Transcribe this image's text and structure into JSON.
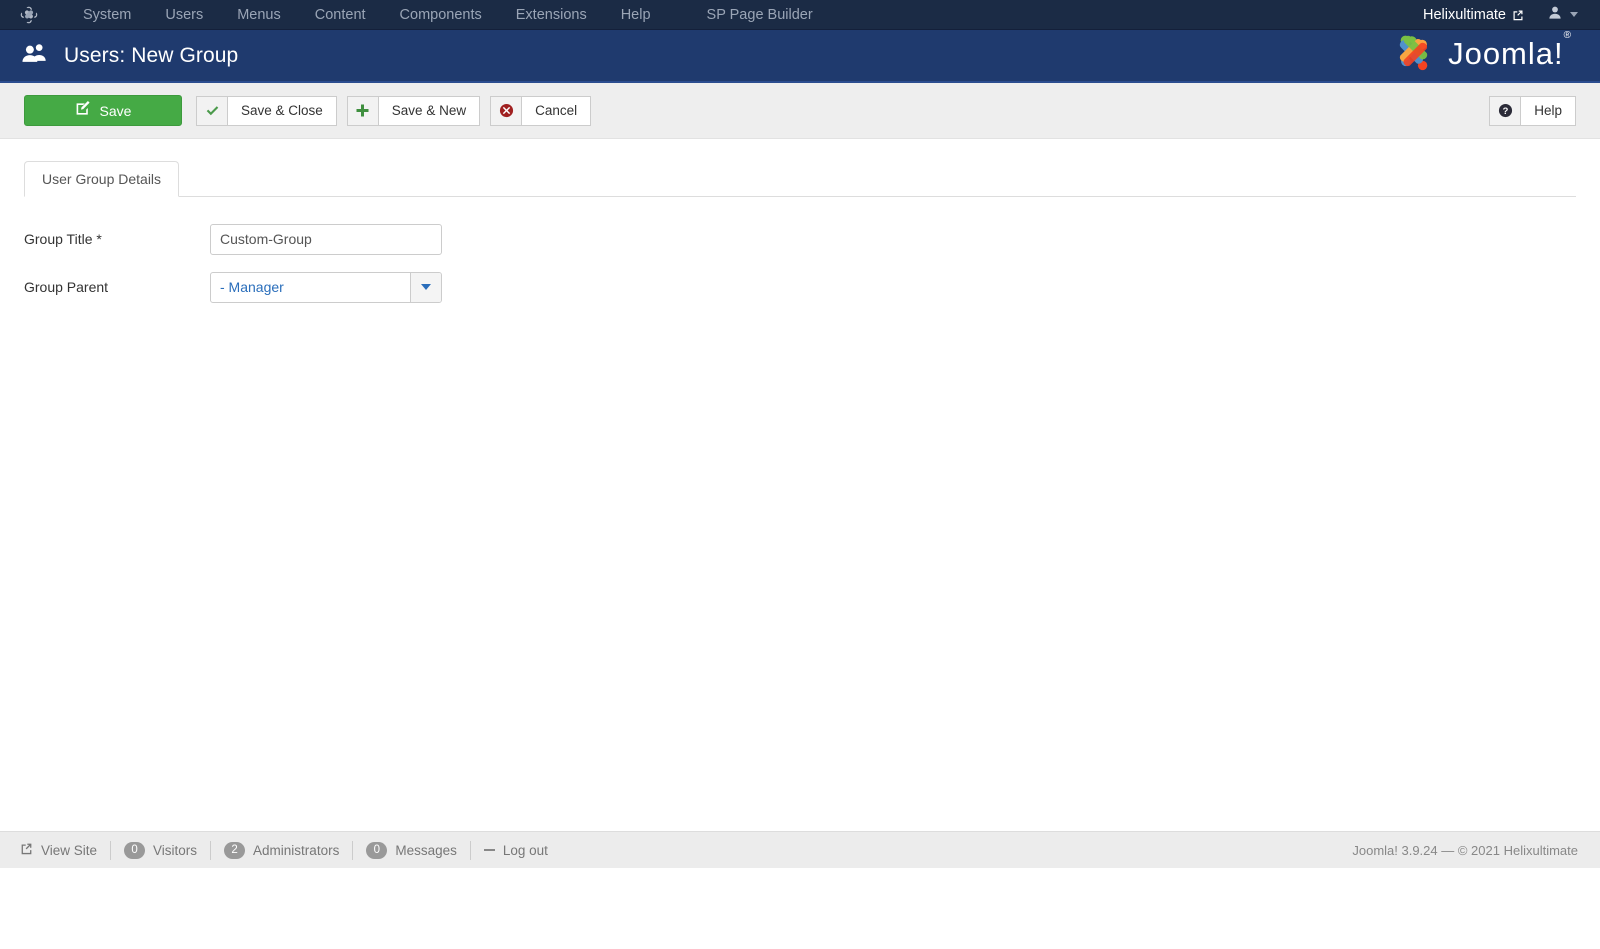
{
  "topbar": {
    "logo_icon": "joomla-logo-icon",
    "menu": [
      {
        "label": "System"
      },
      {
        "label": "Users"
      },
      {
        "label": "Menus"
      },
      {
        "label": "Content"
      },
      {
        "label": "Components"
      },
      {
        "label": "Extensions"
      },
      {
        "label": "Help"
      },
      {
        "label": "SP Page Builder"
      }
    ],
    "site_name": "Helixultimate",
    "site_link_icon": "external-link-icon",
    "user_icon": "user-icon",
    "user_caret_icon": "chevron-down-icon"
  },
  "header": {
    "icon": "users-group-icon",
    "title": "Users: New Group",
    "brand": "Joomla!",
    "brand_sup": "®",
    "brand_icon": "joomla-logo-icon"
  },
  "toolbar": {
    "save": {
      "label": "Save",
      "icon": "save-pencil-icon"
    },
    "save_close": {
      "label": "Save & Close",
      "icon": "check-icon"
    },
    "save_new": {
      "label": "Save & New",
      "icon": "plus-icon"
    },
    "cancel": {
      "label": "Cancel",
      "icon": "cancel-circle-icon"
    },
    "help": {
      "label": "Help",
      "icon": "question-circle-icon"
    },
    "save_color": "#45aa45",
    "cancel_color": "#a02020"
  },
  "main": {
    "tabs": [
      {
        "label": "User Group Details",
        "active": true
      }
    ],
    "fields": {
      "group_title": {
        "label": "Group Title *",
        "value": "Custom-Group",
        "placeholder": ""
      },
      "group_parent": {
        "label": "Group Parent",
        "value": "- Manager",
        "arrow_icon": "chevron-down-icon"
      }
    }
  },
  "statusbar": {
    "view_site": {
      "label": "View Site",
      "icon": "external-link-icon"
    },
    "visitors": {
      "label": "Visitors",
      "count": "0"
    },
    "administrators": {
      "label": "Administrators",
      "count": "2"
    },
    "messages": {
      "label": "Messages",
      "count": "0"
    },
    "logout": {
      "label": "Log out",
      "icon": "minus-icon"
    },
    "copyright": "Joomla! 3.9.24  —  © 2021 Helixultimate"
  }
}
